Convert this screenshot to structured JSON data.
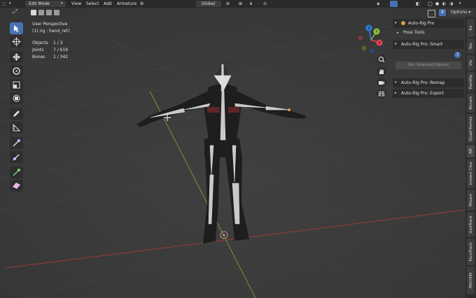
{
  "header": {
    "mode": "Edit Mode",
    "menus": [
      "View",
      "Select",
      "Add",
      "Armature"
    ],
    "orientation": "Global",
    "options": "Options",
    "close_label": "X"
  },
  "viewport_info": {
    "perspective": "User Perspective",
    "active": "(1) rig : hand_ref.l",
    "stats": [
      {
        "label": "Objects",
        "value": "1 / 3"
      },
      {
        "label": "Joints",
        "value": "7 / 619"
      },
      {
        "label": "Bones",
        "value": "1 / 342"
      }
    ]
  },
  "gizmo": {
    "x": "X",
    "y": "Y",
    "z": "Z"
  },
  "npanel": {
    "auto_rig_pro": "Auto-Rig Pro",
    "pose_tools": "Pose Tools",
    "smart": "Auto-Rig Pro: Smart",
    "help": "?",
    "get_selected": "Get Selected Objects",
    "remap": "Auto-Rig Pro: Remap",
    "export": "Auto-Rig Pro: Export"
  },
  "side_tabs": [
    "Ite",
    "Too",
    "Vie",
    "HardOp",
    "Renam",
    "Quad Remes",
    "AR",
    "Instant Clea",
    "Mixam",
    "GeoTrack",
    "FaceTrack",
    "MACHIN"
  ],
  "colors": {
    "accent": "#4772b3",
    "x_axis": "#a63a3a",
    "y_axis": "#6c9a2a",
    "gizmo_x": "#e54554",
    "gizmo_y": "#8ac53c",
    "gizmo_z": "#2f83e0"
  }
}
